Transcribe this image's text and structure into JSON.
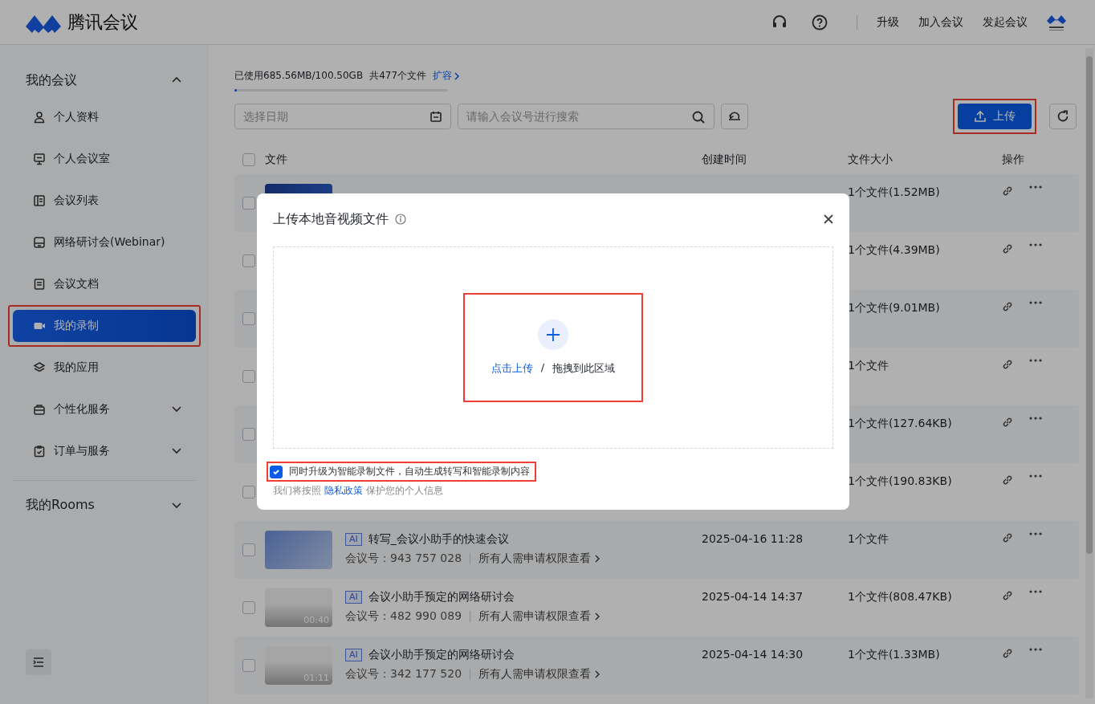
{
  "header": {
    "brand": "腾讯会议",
    "links": [
      "升级",
      "加入会议",
      "发起会议"
    ]
  },
  "sidebar": {
    "items": [
      {
        "kind": "group",
        "label": "我的会议",
        "expanded": true
      },
      {
        "kind": "item",
        "label": "个人资料",
        "selected": false
      },
      {
        "kind": "item",
        "label": "个人会议室",
        "selected": false
      },
      {
        "kind": "item",
        "label": "会议列表",
        "selected": false
      },
      {
        "kind": "item",
        "label": "网络研讨会(Webinar)",
        "selected": false
      },
      {
        "kind": "item",
        "label": "会议文档",
        "selected": false
      },
      {
        "kind": "item",
        "label": "我的录制",
        "selected": true,
        "highlighted": true
      },
      {
        "kind": "item",
        "label": "我的应用",
        "selected": false
      },
      {
        "kind": "item",
        "label": "个性化服务",
        "selected": false,
        "expanded": false
      },
      {
        "kind": "item",
        "label": "订单与服务",
        "selected": false,
        "expanded": false
      },
      {
        "kind": "group",
        "label": "我的Rooms",
        "expanded": false
      }
    ]
  },
  "storage": {
    "usage": "已使用685.56MB/100.50GB",
    "count": "共477个文件",
    "expand_link": "扩容",
    "level": 0.007
  },
  "filters": {
    "date_placeholder": "选择日期",
    "search_placeholder": "请输入会议号进行搜索"
  },
  "upload_button": {
    "label": "上传",
    "highlighted": true
  },
  "table": {
    "select_all_checked": false,
    "columns": [
      "文件",
      "创建时间",
      "文件大小",
      "操作"
    ],
    "rows": [
      {
        "checked": false,
        "size": "1个文件(1.52MB)"
      },
      {
        "checked": false,
        "size": "1个文件(4.39MB)"
      },
      {
        "checked": false,
        "size": "1个文件(9.01MB)"
      },
      {
        "checked": false,
        "size": "1个文件"
      },
      {
        "checked": false,
        "size": "1个文件(127.64KB)"
      },
      {
        "checked": false,
        "size": "1个文件(190.83KB)"
      },
      {
        "checked": false,
        "ai": "AI",
        "name": "转写_会议小助手的快速会议",
        "meeting_id_label": "会议号：",
        "meeting_id": "943 757 028",
        "permission": "所有人需申请权限查看",
        "created": "2025-04-16 11:28",
        "size": "1个文件"
      },
      {
        "checked": false,
        "duration": "00:40",
        "ai": "AI",
        "name": "会议小助手预定的网络研讨会",
        "meeting_id_label": "会议号：",
        "meeting_id": "482 990 089",
        "permission": "所有人需申请权限查看",
        "created": "2025-04-14 14:37",
        "size": "1个文件(808.47KB)"
      },
      {
        "checked": false,
        "duration": "01:11",
        "ai": "AI",
        "name": "会议小助手预定的网络研讨会",
        "meeting_id_label": "会议号：",
        "meeting_id": "342 177 520",
        "permission": "所有人需申请权限查看",
        "created": "2025-04-14 14:30",
        "size": "1个文件(1.33MB)"
      }
    ]
  },
  "dialog": {
    "title": "上传本地音视频文件",
    "upload_link": "点击上传",
    "separator": "/",
    "drop_text": "拖拽到此区域",
    "dropzone_highlighted": true,
    "option": {
      "label": "同时升级为智能录制文件，自动生成转写和智能录制内容",
      "checked": true,
      "highlighted": true
    },
    "privacy_prefix": "我们将按照",
    "privacy_link": "隐私政策",
    "privacy_suffix": "保护您的个人信息"
  }
}
